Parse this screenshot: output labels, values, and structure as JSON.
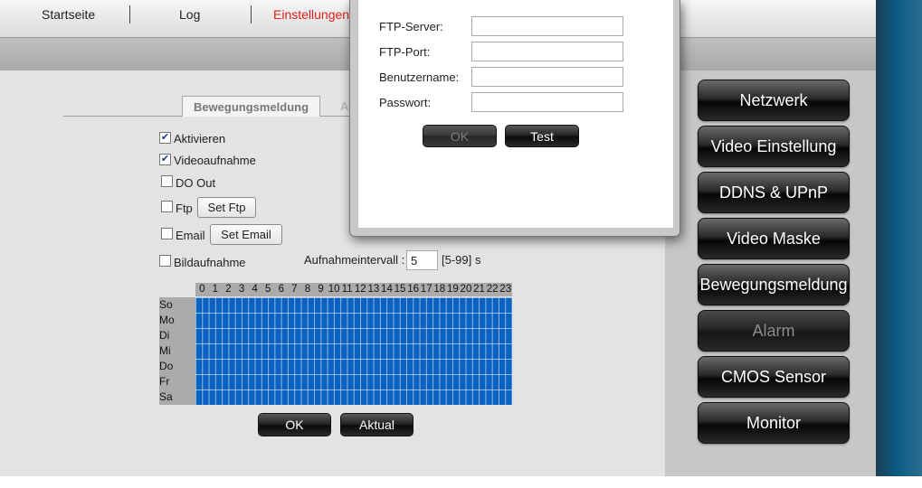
{
  "topnav": {
    "home": "Startseite",
    "log": "Log",
    "settings": "Einstellungen"
  },
  "colors": {
    "active_nav": "#e0201a",
    "schedule_blue": "#0b62c0",
    "deco_blue": "#0c5a83"
  },
  "side_menu": [
    {
      "label": "Netzwerk",
      "enabled": true
    },
    {
      "label": "Video Einstellung",
      "enabled": true
    },
    {
      "label": "DDNS & UPnP",
      "enabled": true
    },
    {
      "label": "Video Maske",
      "enabled": true
    },
    {
      "label": "Bewegungsmeldung",
      "enabled": true
    },
    {
      "label": "Alarm",
      "enabled": false
    },
    {
      "label": "CMOS Sensor",
      "enabled": true
    },
    {
      "label": "Monitor",
      "enabled": true
    }
  ],
  "tabs": {
    "active": "Bewegungsmeldung",
    "next_partial": "A"
  },
  "options": {
    "activate": {
      "label": "Aktivieren",
      "checked": true
    },
    "video_recording": {
      "label": "Videoaufnahme",
      "checked": true
    },
    "do_out": {
      "label": "DO Out",
      "checked": false
    },
    "ftp": {
      "label": "Ftp",
      "checked": false,
      "button": "Set Ftp"
    },
    "email": {
      "label": "Email",
      "checked": false,
      "button": "Set Email"
    },
    "snapshot": {
      "label": "Bildaufnahme",
      "checked": false
    }
  },
  "interval": {
    "label": "Aufnahmeintervall :",
    "value": "5",
    "range": "[5-99]",
    "unit": "s"
  },
  "schedule": {
    "hours": [
      "0",
      "1",
      "2",
      "3",
      "4",
      "5",
      "6",
      "7",
      "8",
      "9",
      "10",
      "11",
      "12",
      "13",
      "14",
      "15",
      "16",
      "17",
      "18",
      "19",
      "20",
      "21",
      "22",
      "23"
    ],
    "days": [
      "So",
      "Mo",
      "Di",
      "Mi",
      "Do",
      "Fr",
      "Sa"
    ]
  },
  "buttons": {
    "ok": "OK",
    "refresh": "Aktual"
  },
  "ftp_dialog": {
    "server_label": "FTP-Server:",
    "server_value": "",
    "port_label": "FTP-Port:",
    "port_value": "",
    "user_label": "Benutzername:",
    "user_value": "",
    "password_label": "Passwort:",
    "password_value": "",
    "ok": "OK",
    "test": "Test"
  }
}
